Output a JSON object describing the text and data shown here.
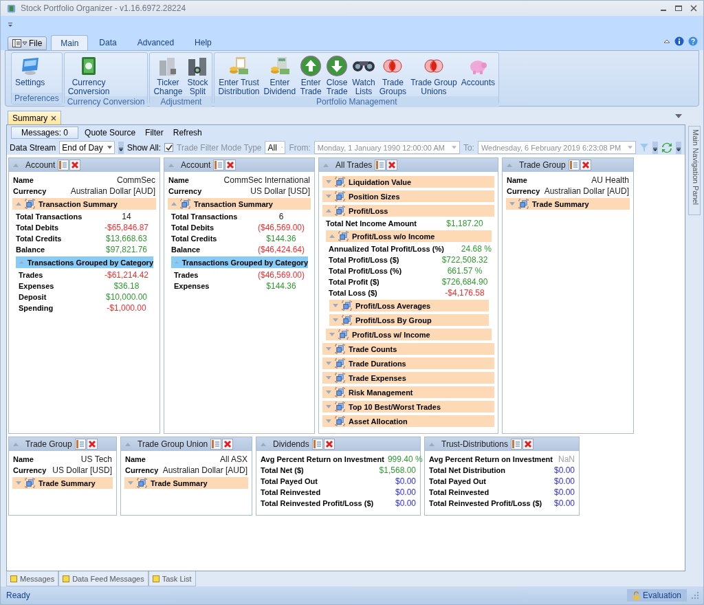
{
  "window": {
    "title": "Stock Portfolio Organizer - v1.16.6972.28224"
  },
  "ribbon": {
    "file_label": "File",
    "tabs": [
      {
        "label": "Main",
        "selected": true
      },
      {
        "label": "Data",
        "selected": false
      },
      {
        "label": "Advanced",
        "selected": false
      },
      {
        "label": "Help",
        "selected": false
      }
    ],
    "groups": [
      {
        "label": "Preferences",
        "buttons": [
          {
            "label": "Settings"
          }
        ]
      },
      {
        "label": "Currency Conversion",
        "buttons": [
          {
            "label": "Currency\nConversion"
          }
        ]
      },
      {
        "label": "Adjustment",
        "buttons": [
          {
            "label": "Ticker\nChange"
          },
          {
            "label": "Stock\nSplit"
          }
        ]
      },
      {
        "label": "Portfolio Management",
        "buttons": [
          {
            "label": "Enter Trust\nDistribution"
          },
          {
            "label": "Enter\nDividend"
          },
          {
            "label": "Enter\nTrade"
          },
          {
            "label": "Close\nTrade"
          },
          {
            "label": "Watch\nLists"
          },
          {
            "label": "Trade\nGroups"
          },
          {
            "label": "Trade Group\nUnions"
          },
          {
            "label": "Accounts"
          }
        ]
      }
    ]
  },
  "document_tabs": [
    {
      "label": "Summary",
      "selected": true
    }
  ],
  "toolbar": {
    "messages_button": "Messages: 0",
    "links": [
      "Quote Source",
      "Filter",
      "Refresh"
    ],
    "data_stream": {
      "label": "Data Stream",
      "value": "End of Day"
    },
    "show_all": {
      "label": "Show All:",
      "checked": true
    },
    "filter_mode": {
      "label": "Trade Filter Mode Type",
      "value": "All",
      "disabled": true
    },
    "from": {
      "label": "From:",
      "value": "Monday, 1 January 1990 12:00:00 AM",
      "disabled": true
    },
    "to": {
      "label": "To:",
      "value": "Wednesday, 6 February 2019 6:23:08 PM",
      "disabled": true
    }
  },
  "top_panels": [
    {
      "title": "Account",
      "items": [
        {
          "kind": "field",
          "label": "Name",
          "value": "CommSec"
        },
        {
          "kind": "field",
          "label": "Currency",
          "value": "Australian Dollar [AUD]"
        },
        {
          "kind": "section",
          "title": "Transaction Summary",
          "expanded": true,
          "items": [
            {
              "kind": "field",
              "label": "Total Transactions",
              "value": "14"
            },
            {
              "kind": "field",
              "label": "Total Debits",
              "value": "-$65,846.87",
              "color": "#ff2a2a"
            },
            {
              "kind": "field",
              "label": "Total Credits",
              "value": "$13,668.63",
              "color": "#2e9a2e"
            },
            {
              "kind": "field",
              "label": "Balance",
              "value": "$97,821.76",
              "color": "#2e9a2e"
            },
            {
              "kind": "category",
              "title": "Transactions Grouped by Category",
              "expanded": true,
              "items": [
                {
                  "kind": "field",
                  "label": "Trades",
                  "value": "-$61,214.42",
                  "color": "#ff2a2a"
                },
                {
                  "kind": "field",
                  "label": "Expenses",
                  "value": "$36.18",
                  "color": "#2e9a2e"
                },
                {
                  "kind": "field",
                  "label": "Deposit",
                  "value": "$10,000.00",
                  "color": "#2e9a2e"
                },
                {
                  "kind": "field",
                  "label": "Spending",
                  "value": "-$1,000.00",
                  "color": "#ff2a2a"
                }
              ]
            }
          ]
        }
      ]
    },
    {
      "title": "Account",
      "items": [
        {
          "kind": "field",
          "label": "Name",
          "value": "CommSec International"
        },
        {
          "kind": "field",
          "label": "Currency",
          "value": "US Dollar [USD]"
        },
        {
          "kind": "section",
          "title": "Transaction Summary",
          "expanded": true,
          "items": [
            {
              "kind": "field",
              "label": "Total Transactions",
              "value": "6"
            },
            {
              "kind": "field",
              "label": "Total Debits",
              "value": "($46,569.00)",
              "color": "#ff2a2a"
            },
            {
              "kind": "field",
              "label": "Total Credits",
              "value": "$144.36",
              "color": "#2e9a2e"
            },
            {
              "kind": "field",
              "label": "Balance",
              "value": "($46,424.64)",
              "color": "#ff2a2a"
            },
            {
              "kind": "category",
              "title": "Transactions Grouped by Category",
              "expanded": true,
              "items": [
                {
                  "kind": "field",
                  "label": "Trades",
                  "value": "($46,569.00)",
                  "color": "#ff2a2a"
                },
                {
                  "kind": "field",
                  "label": "Expenses",
                  "value": "$144.36",
                  "color": "#2e9a2e"
                }
              ]
            }
          ]
        }
      ]
    },
    {
      "title": "All Trades",
      "items": [
        {
          "kind": "section",
          "title": "Liquidation Value",
          "expanded": false
        },
        {
          "kind": "section",
          "title": "Position Sizes",
          "expanded": false
        },
        {
          "kind": "section",
          "title": "Profit/Loss",
          "expanded": true,
          "items": [
            {
              "kind": "field",
              "label": "Total Net Income Amount",
              "value": "$1,187.20",
              "color": "#2e9a2e"
            },
            {
              "kind": "section",
              "title": "Profit/Loss w/o Income",
              "expanded": true,
              "items": [
                {
                  "kind": "field",
                  "label": "Annualized Total Profit/Loss (%)",
                  "value": "24.68 %",
                  "color": "#2e9a2e"
                },
                {
                  "kind": "field",
                  "label": "Total Profit/Loss ($)",
                  "value": "$722,508.32",
                  "color": "#2e9a2e"
                },
                {
                  "kind": "field",
                  "label": "Total Profit/Loss (%)",
                  "value": "661.57 %",
                  "color": "#2e9a2e"
                },
                {
                  "kind": "field",
                  "label": "Total Profit ($)",
                  "value": "$726,684.90",
                  "color": "#2e9a2e"
                },
                {
                  "kind": "field",
                  "label": "Total Loss ($)",
                  "value": "-$4,176.58",
                  "color": "#ff2a2a"
                },
                {
                  "kind": "section",
                  "title": "Profit/Loss Averages",
                  "expanded": false
                },
                {
                  "kind": "section",
                  "title": "Profit/Loss By Group",
                  "expanded": false
                }
              ]
            },
            {
              "kind": "section",
              "title": "Profit/Loss w/ Income",
              "expanded": false
            }
          ]
        },
        {
          "kind": "section",
          "title": "Trade Counts",
          "expanded": false
        },
        {
          "kind": "section",
          "title": "Trade Durations",
          "expanded": false
        },
        {
          "kind": "section",
          "title": "Trade Expenses",
          "expanded": false
        },
        {
          "kind": "section",
          "title": "Risk Management",
          "expanded": false
        },
        {
          "kind": "section",
          "title": "Top 10 Best/Worst Trades",
          "expanded": false
        },
        {
          "kind": "section",
          "title": "Asset Allocation",
          "expanded": false
        }
      ]
    },
    {
      "title": "Trade Group",
      "items": [
        {
          "kind": "field",
          "label": "Name",
          "value": "AU Health"
        },
        {
          "kind": "field",
          "label": "Currency",
          "value": "Australian Dollar [AUD]"
        },
        {
          "kind": "section",
          "title": "Trade Summary",
          "expanded": false
        }
      ]
    }
  ],
  "bottom_panels": [
    {
      "title": "Trade Group",
      "items": [
        {
          "kind": "field",
          "label": "Name",
          "value": "US Tech"
        },
        {
          "kind": "field",
          "label": "Currency",
          "value": "US Dollar [USD]"
        },
        {
          "kind": "section",
          "title": "Trade Summary",
          "expanded": false
        }
      ]
    },
    {
      "title": "Trade Group Union",
      "items": [
        {
          "kind": "field",
          "label": "Name",
          "value": "All ASX"
        },
        {
          "kind": "field",
          "label": "Currency",
          "value": "Australian Dollar [AUD]"
        },
        {
          "kind": "section",
          "title": "Trade Summary",
          "expanded": false
        }
      ]
    },
    {
      "title": "Dividends",
      "items": [
        {
          "kind": "field",
          "label": "Avg Percent Return on Investment",
          "value": "999.40 %",
          "color": "#2e9a2e"
        },
        {
          "kind": "field",
          "label": "Total Net ($)",
          "value": "$1,568.00",
          "color": "#2e9a2e"
        },
        {
          "kind": "field",
          "label": "Total Payed Out",
          "value": "$0.00",
          "color": "#2a2aff"
        },
        {
          "kind": "field",
          "label": "Total Reinvested",
          "value": "$0.00",
          "color": "#2a2aff"
        },
        {
          "kind": "field",
          "label": "Total Reinvested Profit/Loss ($)",
          "value": "$0.00",
          "color": "#2a2aff"
        }
      ]
    },
    {
      "title": "Trust-Distributions",
      "items": [
        {
          "kind": "field",
          "label": "Avg Percent Return on Investment",
          "value": "NaN",
          "color": "#a0a0a0"
        },
        {
          "kind": "field",
          "label": "Total Net Distribution",
          "value": "$0.00",
          "color": "#2a2aff"
        },
        {
          "kind": "field",
          "label": "Total Payed Out",
          "value": "$0.00",
          "color": "#2a2aff"
        },
        {
          "kind": "field",
          "label": "Total Reinvested",
          "value": "$0.00",
          "color": "#2a2aff"
        },
        {
          "kind": "field",
          "label": "Total Reinvested Profit/Loss ($)",
          "value": "$0.00",
          "color": "#2a2aff"
        }
      ]
    }
  ],
  "side_panel": {
    "label": "Main Navigation Panel"
  },
  "bottom_tabs": [
    "Messages",
    "Data Feed Messages",
    "Task List"
  ],
  "status_bar": {
    "text": "Ready",
    "badge": "Evaluation"
  }
}
